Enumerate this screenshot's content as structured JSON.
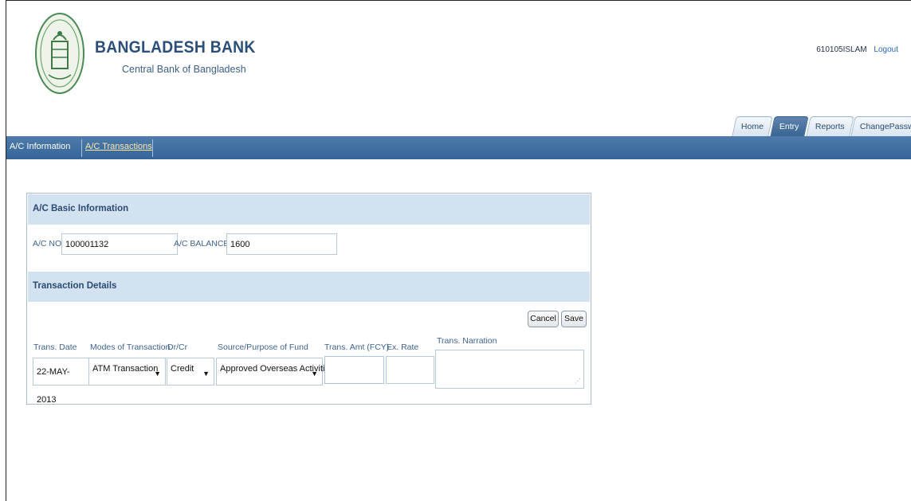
{
  "header": {
    "bank_name": "BANGLADESH BANK",
    "bank_subtitle": "Central Bank of Bangladesh",
    "user_id": "610105ISLAM",
    "logout_label": "Logout"
  },
  "top_tabs": [
    {
      "label": "Home",
      "active": false
    },
    {
      "label": "Entry",
      "active": true
    },
    {
      "label": "Reports",
      "active": false
    },
    {
      "label": "ChangePassword",
      "active": false
    }
  ],
  "nav": {
    "item1": "A/C Information",
    "item2": "A/C Transactions"
  },
  "basic_info": {
    "title": "A/C Basic Information",
    "ac_no_label": "A/C NO:",
    "ac_no_value": "100001132",
    "ac_balance_label": "A/C BALANCE:",
    "ac_balance_value": "1600"
  },
  "transaction": {
    "title": "Transaction Details",
    "cancel_label": "Cancel",
    "save_label": "Save",
    "trans_date_label": "Trans. Date",
    "trans_date_value": "22-MAY-2013",
    "modes_label": "Modes of Transaction",
    "modes_value": "ATM Transaction",
    "drcr_label": "Dr/Cr",
    "drcr_value": "Credit",
    "source_label": "Source/Purpose of Fund",
    "source_value": "Approved Overseas Activitie",
    "amt_label": "Trans. Amt (FCY)",
    "amt_value": "",
    "rate_label": "Ex. Rate",
    "rate_value": "",
    "narration_label": "Trans. Narration",
    "narration_value": ""
  },
  "colors": {
    "navbar": "#3f6fa2",
    "section_header": "#d3e2f1",
    "label_text": "#3e6390"
  }
}
